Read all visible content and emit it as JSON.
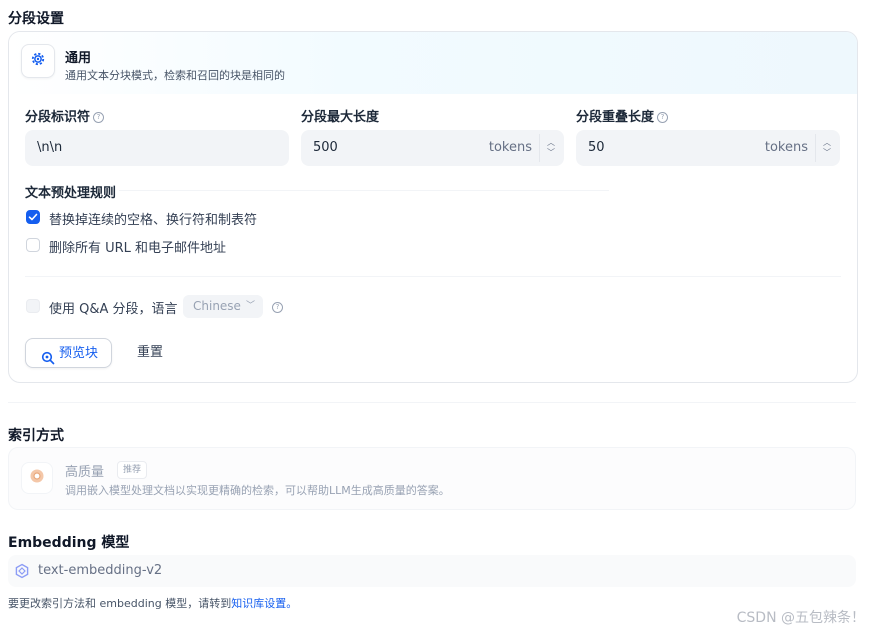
{
  "segment_settings": {
    "title": "分段设置",
    "general": {
      "title": "通用",
      "description": "通用文本分块模式，检索和召回的块是相同的",
      "icon": "gear-icon"
    },
    "separator": {
      "label": "分段标识符",
      "value": "\\n\\n"
    },
    "max_length": {
      "label": "分段最大长度",
      "value": "500",
      "unit": "tokens"
    },
    "overlap": {
      "label": "分段重叠长度",
      "value": "50",
      "unit": "tokens"
    },
    "preprocess": {
      "title": "文本预处理规则",
      "rules": [
        {
          "label": "替换掉连续的空格、换行符和制表符",
          "checked": true
        },
        {
          "label": "删除所有 URL 和电子邮件地址",
          "checked": false
        }
      ]
    },
    "qa": {
      "label": "使用 Q&A 分段，语言",
      "language": "Chinese"
    },
    "preview_button": "预览块",
    "reset_button": "重置"
  },
  "index_method": {
    "title": "索引方式",
    "option": {
      "title": "高质量",
      "badge": "推荐",
      "description": "调用嵌入模型处理文档以实现更精确的检索，可以帮助LLM生成高质量的答案。"
    }
  },
  "embedding": {
    "title": "Embedding 模型",
    "model": "text-embedding-v2",
    "note_prefix": "要更改索引方法和 embedding 模型，请转到",
    "note_link": "知识库设置。"
  },
  "watermark": "CSDN @五包辣条！",
  "colors": {
    "accent": "#155eef",
    "link": "#155eef"
  }
}
